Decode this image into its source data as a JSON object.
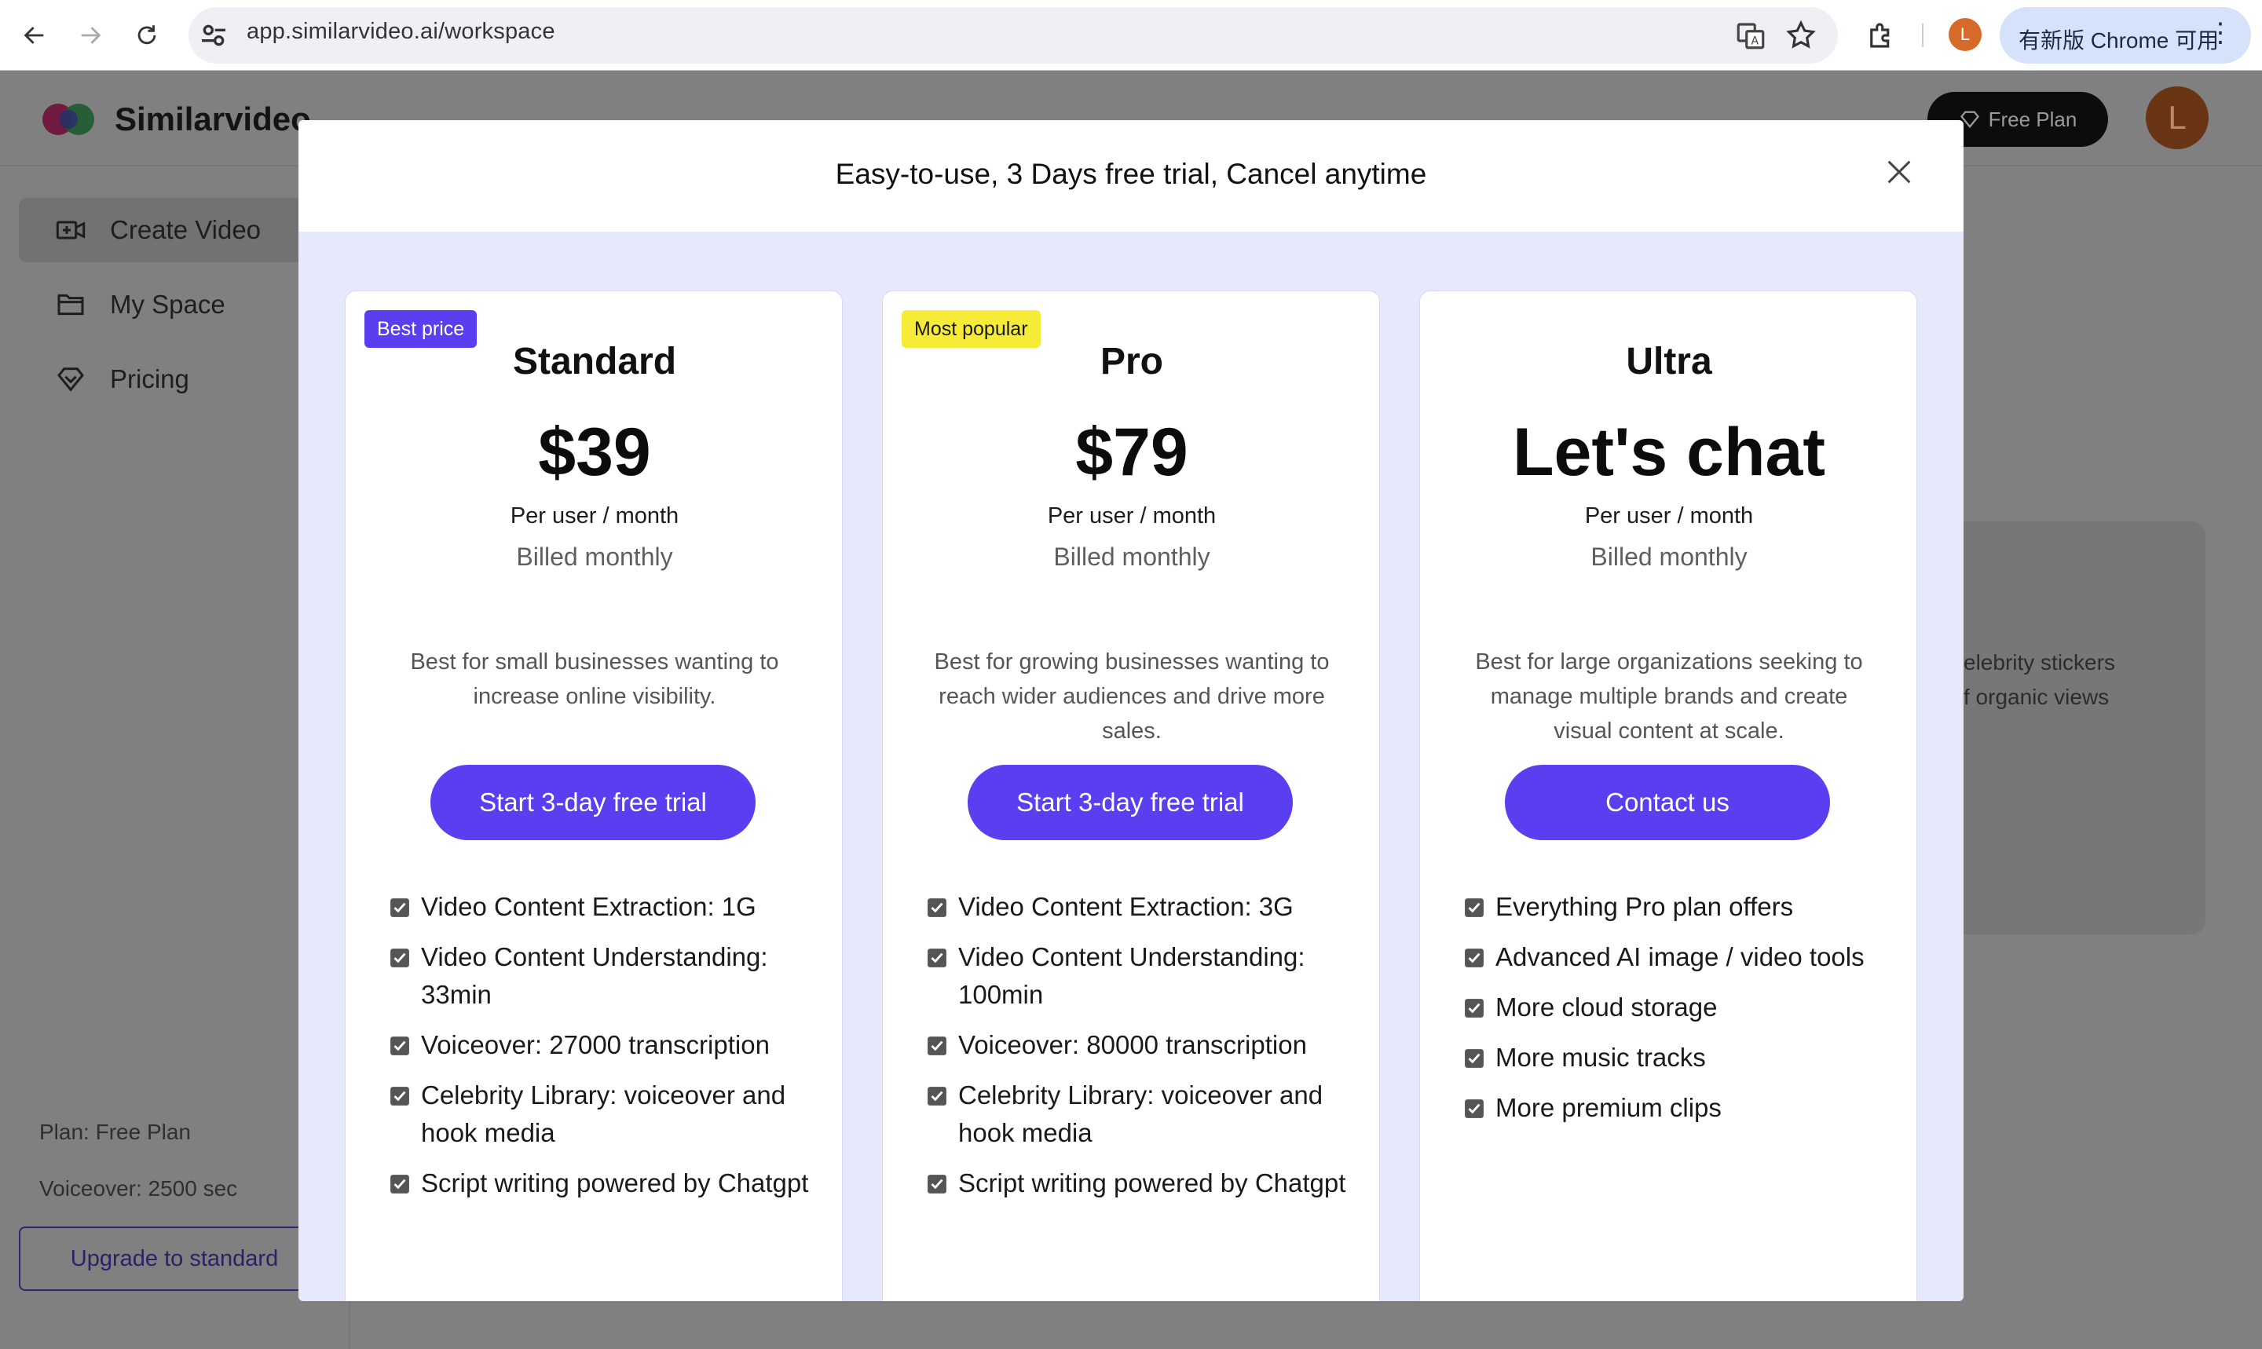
{
  "browser": {
    "url": "app.similarvideo.ai/workspace",
    "profile_initial": "L",
    "update_label": "有新版 Chrome 可用"
  },
  "app": {
    "brand": "Similarvideo",
    "plan_button_label": "Free Plan",
    "avatar_initial": "L",
    "sidebar": {
      "items": [
        {
          "label": "Create Video",
          "icon": "video-camera-icon"
        },
        {
          "label": "My Space",
          "icon": "folder-icon"
        },
        {
          "label": "Pricing",
          "icon": "diamond-icon"
        }
      ],
      "plan_info": "Plan: Free Plan",
      "voiceover_info": "Voiceover: 2500 sec",
      "upgrade_label": "Upgrade to standard"
    },
    "background_card": {
      "line1": "elebrity stickers",
      "line2": "f organic views"
    }
  },
  "modal": {
    "title": "Easy-to-use, 3 Days free trial, Cancel anytime",
    "plans": [
      {
        "badge": "Best price",
        "name": "Standard",
        "price": "$39",
        "per": "Per user / month",
        "billing": "Billed monthly",
        "description": "Best for small businesses wanting to increase online visibility.",
        "cta": "Start 3-day free trial",
        "features": [
          "Video Content Extraction: 1G",
          "Video Content Understanding: 33min",
          "Voiceover: 27000 transcription",
          "Celebrity Library: voiceover and hook media",
          "Script writing powered by Chatgpt"
        ]
      },
      {
        "badge": "Most popular",
        "name": "Pro",
        "price": "$79",
        "per": "Per user / month",
        "billing": "Billed monthly",
        "description": "Best for growing businesses wanting to reach wider audiences and drive more sales.",
        "cta": "Start 3-day free trial",
        "features": [
          "Video Content Extraction: 3G",
          "Video Content Understanding: 100min",
          "Voiceover: 80000 transcription",
          "Celebrity Library: voiceover and hook media",
          "Script writing powered by Chatgpt"
        ]
      },
      {
        "name": "Ultra",
        "price": "Let's chat",
        "per": "Per user / month",
        "billing": "Billed monthly",
        "description": "Best for large organizations seeking to manage multiple brands and create visual content at scale.",
        "cta": "Contact us",
        "features": [
          "Everything Pro plan offers",
          "Advanced AI image / video tools",
          "More cloud storage",
          "More music tracks",
          "More premium clips"
        ]
      }
    ]
  },
  "colors": {
    "accent": "#5a3ff0",
    "badge_popular": "#f6ec38",
    "modal_bg": "#e6e8fb"
  }
}
